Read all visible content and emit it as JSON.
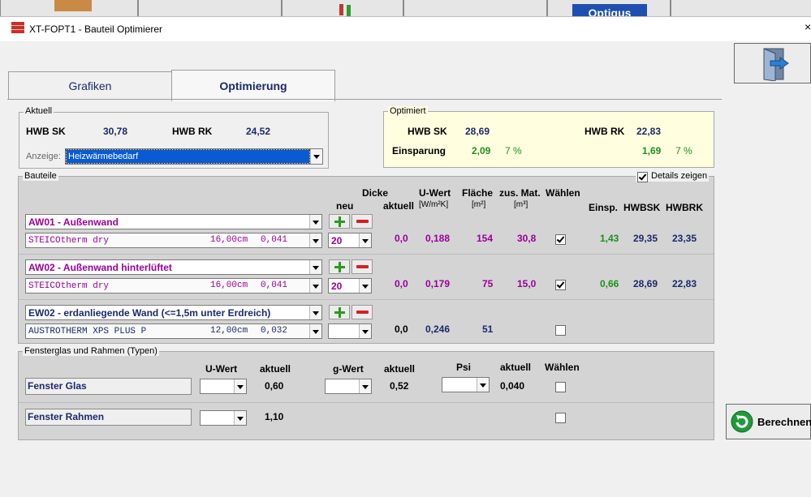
{
  "window": {
    "title": "XT-FOPT1 - Bauteil Optimierer",
    "close_glyph": "×"
  },
  "tabs": [
    {
      "label": "Grafiken",
      "active": false
    },
    {
      "label": "Optimierung",
      "active": true
    }
  ],
  "top_partial_text": "Optigus",
  "aktuell": {
    "group_label": "Aktuell",
    "hwb_sk_label": "HWB SK",
    "hwb_sk_value": "30,78",
    "hwb_rk_label": "HWB RK",
    "hwb_rk_value": "24,52",
    "anzeige_label": "Anzeige:",
    "anzeige_value": "Heizwärmebedarf"
  },
  "optimiert": {
    "group_label": "Optimiert",
    "hwb_sk_label": "HWB SK",
    "hwb_sk_value": "28,69",
    "hwb_rk_label": "HWB RK",
    "hwb_rk_value": "22,83",
    "einsparung_label": "Einsparung",
    "einsparung_sk_value": "2,09",
    "einsparung_sk_pct": "7 %",
    "einsparung_rk_value": "1,69",
    "einsparung_rk_pct": "7 %"
  },
  "bauteile": {
    "group_label": "Bauteile",
    "details_label": "Details zeigen",
    "details_checked": true,
    "headers": {
      "dicke": "Dicke",
      "neu": "neu",
      "aktuell": "aktuell",
      "uwert": "U-Wert",
      "uwert_unit": "[W/m²K]",
      "flaeche": "Fläche",
      "flaeche_unit": "[m²]",
      "zusmat": "zus. Mat.",
      "zusmat_unit": "[m³]",
      "waehlen": "Wählen",
      "einsp": "Einsp.",
      "hwbsk": "HWBSK",
      "hwbrk": "HWBRK"
    },
    "rows": [
      {
        "name": "AW01 - Außenwand",
        "material": "STEICOtherm dry",
        "mat_dicke": "16,00cm",
        "mat_lambda": "0,041",
        "neu": "20",
        "aktuell": "0,0",
        "uwert": "0,188",
        "flaeche": "154",
        "zusmat": "30,8",
        "waehlen": true,
        "einsp": "1,43",
        "hwbsk": "29,35",
        "hwbrk": "23,35"
      },
      {
        "name": "AW02 - Außenwand hinterlüftet",
        "material": "STEICOtherm dry",
        "mat_dicke": "16,00cm",
        "mat_lambda": "0,041",
        "neu": "20",
        "aktuell": "0,0",
        "uwert": "0,179",
        "flaeche": "75",
        "zusmat": "15,0",
        "waehlen": true,
        "einsp": "0,66",
        "hwbsk": "28,69",
        "hwbrk": "22,83"
      },
      {
        "name": "EW02 - erdanliegende Wand (<=1,5m unter Erdreich)",
        "material": "AUSTROTHERM XPS PLUS P",
        "mat_dicke": "12,00cm",
        "mat_lambda": "0,032",
        "neu": "",
        "aktuell": "0,0",
        "uwert": "0,246",
        "flaeche": "51",
        "zusmat": "",
        "waehlen": false,
        "einsp": "",
        "hwbsk": "",
        "hwbrk": ""
      }
    ]
  },
  "fenster": {
    "group_label": "Fensterglas und Rahmen  (Typen)",
    "headers": {
      "uwert": "U-Wert",
      "aktuell1": "aktuell",
      "gwert": "g-Wert",
      "aktuell2": "aktuell",
      "psi": "Psi",
      "aktuell3": "aktuell",
      "waehlen": "Wählen"
    },
    "rows": [
      {
        "name": "Fenster Glas",
        "uwert_aktuell": "0,60",
        "gwert_aktuell": "0,52",
        "psi_aktuell": "0,040",
        "waehlen": false
      },
      {
        "name": "Fenster Rahmen",
        "uwert_aktuell": "1,10",
        "waehlen": false
      }
    ]
  },
  "buttons": {
    "berechnen": "Berechnen"
  }
}
